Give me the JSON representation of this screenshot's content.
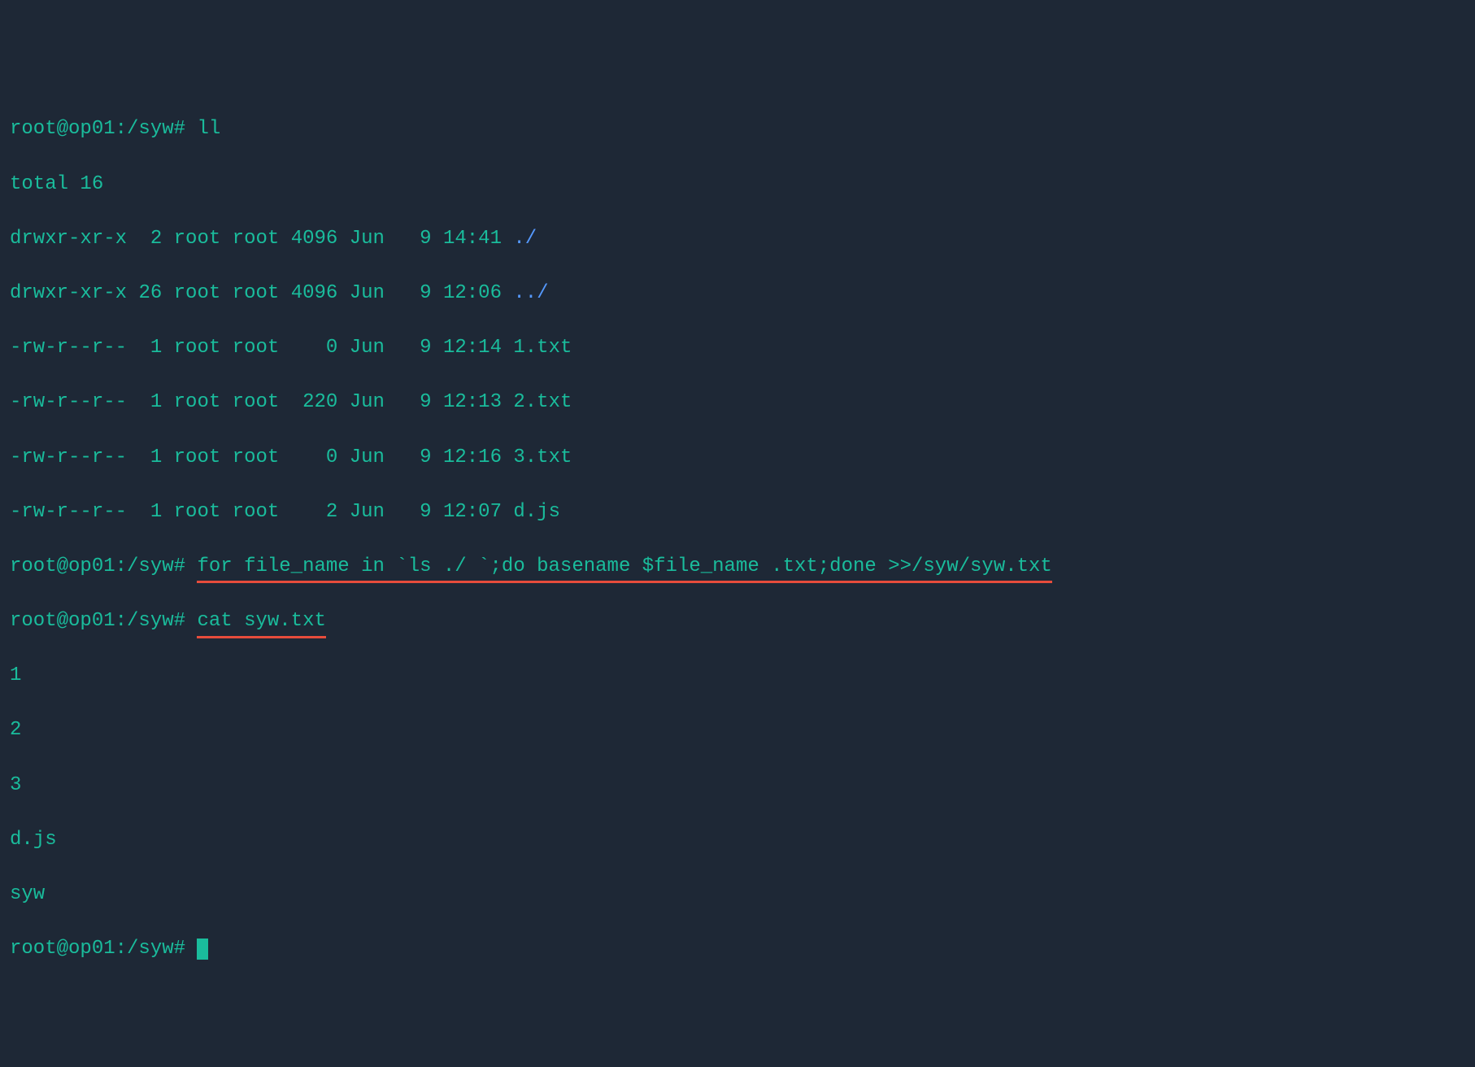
{
  "prompt": "root@op01:/syw#",
  "cmd_ll": "ll",
  "total": "total 16",
  "files": [
    {
      "perm": "drwxr-xr-x",
      "links": " 2",
      "owner": "root",
      "group": "root",
      "size": "4096",
      "month": "Jun",
      "day": " 9",
      "time": "14:41",
      "name": "./",
      "class": "blue"
    },
    {
      "perm": "drwxr-xr-x",
      "links": "26",
      "owner": "root",
      "group": "root",
      "size": "4096",
      "month": "Jun",
      "day": " 9",
      "time": "12:06",
      "name": "../",
      "class": "blue"
    },
    {
      "perm": "-rw-r--r--",
      "links": " 1",
      "owner": "root",
      "group": "root",
      "size": "   0",
      "month": "Jun",
      "day": " 9",
      "time": "12:14",
      "name": "1.txt",
      "class": ""
    },
    {
      "perm": "-rw-r--r--",
      "links": " 1",
      "owner": "root",
      "group": "root",
      "size": " 220",
      "month": "Jun",
      "day": " 9",
      "time": "12:13",
      "name": "2.txt",
      "class": ""
    },
    {
      "perm": "-rw-r--r--",
      "links": " 1",
      "owner": "root",
      "group": "root",
      "size": "   0",
      "month": "Jun",
      "day": " 9",
      "time": "12:16",
      "name": "3.txt",
      "class": ""
    },
    {
      "perm": "-rw-r--r--",
      "links": " 1",
      "owner": "root",
      "group": "root",
      "size": "   2",
      "month": "Jun",
      "day": " 9",
      "time": "12:07",
      "name": "d.js",
      "class": ""
    }
  ],
  "cmd_for": "for file_name in `ls ./ `;do basename $file_name .txt;done >>/syw/syw.txt",
  "cmd_cat": "cat syw.txt",
  "cat_output": [
    "1",
    "2",
    "3",
    "d.js",
    "syw"
  ]
}
